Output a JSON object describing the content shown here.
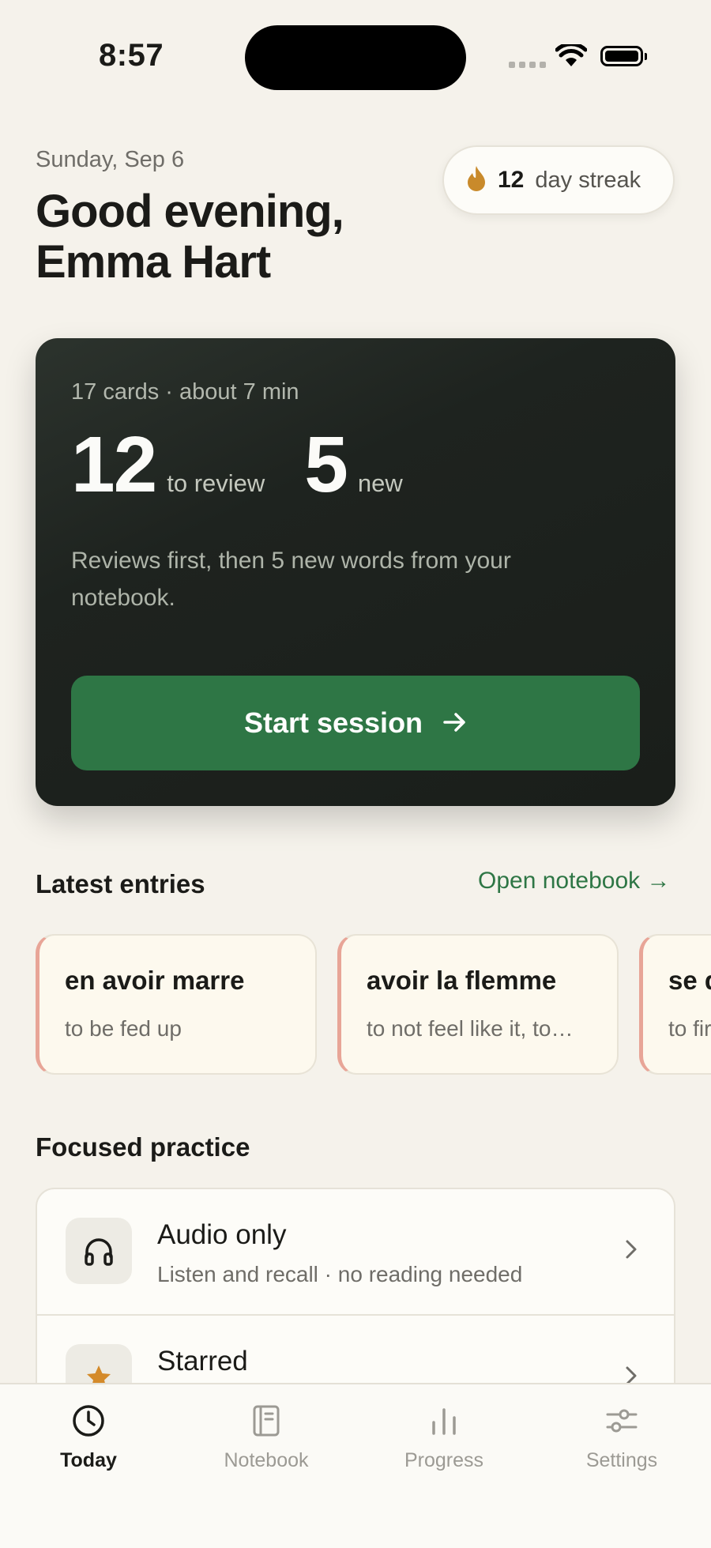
{
  "status_bar": {
    "time": "8:57"
  },
  "header": {
    "date": "Sunday, Sep 6",
    "greeting_line1": "Good evening,",
    "greeting_line2": "Emma Hart",
    "streak_count": "12",
    "streak_label": "day streak"
  },
  "session": {
    "meta": "17 cards · about 7 min",
    "review_count": "12",
    "review_label": "to review",
    "new_count": "5",
    "new_label": "new",
    "description": "Reviews first, then 5 new words from your notebook.",
    "start_label": "Start session"
  },
  "latest": {
    "title": "Latest entries",
    "open_link": "Open notebook →",
    "entries": [
      {
        "word": "en avoir marre",
        "definition": "to be fed up"
      },
      {
        "word": "avoir la flemme",
        "definition": "to not feel like it, to…"
      },
      {
        "word": "se d",
        "definition": "to fir"
      }
    ]
  },
  "practice": {
    "title": "Focused practice",
    "items": [
      {
        "title": "Audio only",
        "subtitle": "Listen and recall · no reading needed",
        "icon": "headphones-icon"
      },
      {
        "title": "Starred",
        "subtitle": "",
        "icon": "star-icon"
      }
    ]
  },
  "tabs": [
    {
      "label": "Today",
      "icon": "clock-icon",
      "active": true
    },
    {
      "label": "Notebook",
      "icon": "notebook-icon",
      "active": false
    },
    {
      "label": "Progress",
      "icon": "bar-chart-icon",
      "active": false
    },
    {
      "label": "Settings",
      "icon": "sliders-icon",
      "active": false
    }
  ],
  "colors": {
    "background": "#f5f2eb",
    "accent_green": "#2e7645",
    "card_dark": "#1e231f",
    "streak_flame": "#c98a2b",
    "entry_accent": "#e8a597"
  }
}
